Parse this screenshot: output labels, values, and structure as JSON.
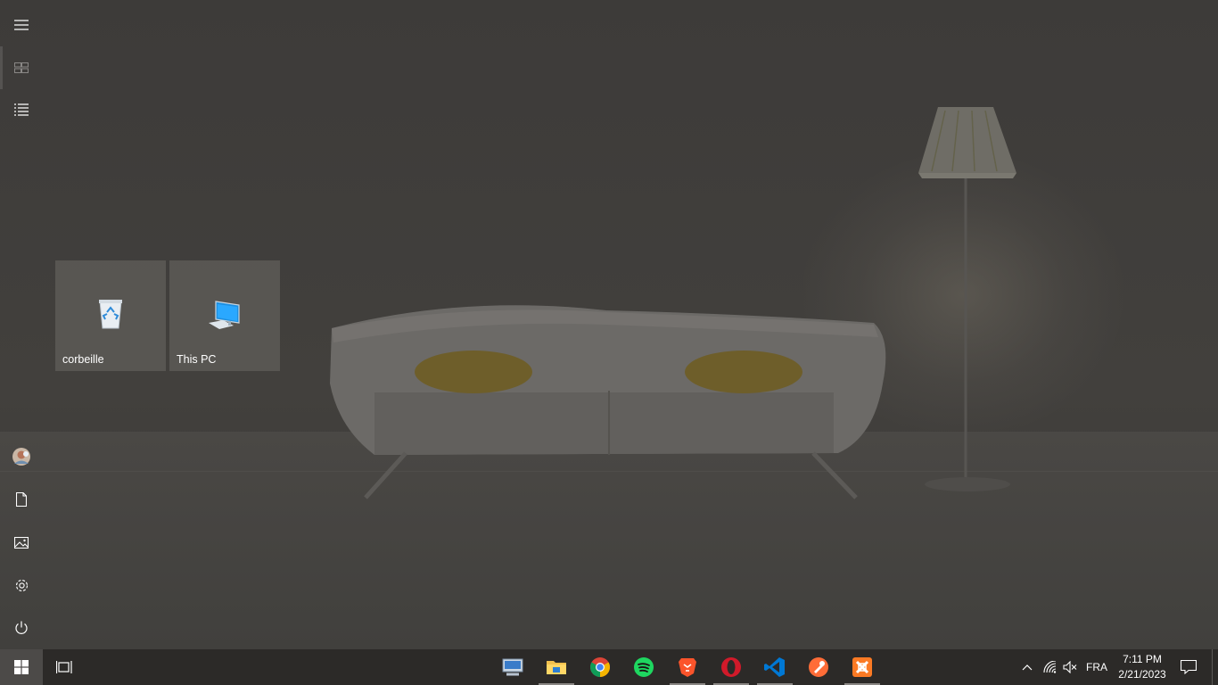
{
  "start_menu": {
    "rail_top": [
      {
        "name": "hamburger-icon"
      },
      {
        "name": "tiles-icon"
      },
      {
        "name": "all-apps-list-icon"
      }
    ],
    "rail_bottom": [
      {
        "name": "user-avatar"
      },
      {
        "name": "documents-icon"
      },
      {
        "name": "pictures-icon"
      },
      {
        "name": "settings-gear-icon"
      },
      {
        "name": "power-icon"
      }
    ],
    "tiles": [
      {
        "label": "corbeille",
        "icon": "recycle-bin-icon"
      },
      {
        "label": "This PC",
        "icon": "computer-icon"
      }
    ]
  },
  "taskbar": {
    "start_icon": "windows-logo-icon",
    "task_view_icon": "task-view-icon",
    "apps": [
      {
        "name": "remote-desktop-icon",
        "running": false
      },
      {
        "name": "file-explorer-icon",
        "running": true
      },
      {
        "name": "chrome-icon",
        "running": false
      },
      {
        "name": "spotify-icon",
        "running": false
      },
      {
        "name": "brave-icon",
        "running": true
      },
      {
        "name": "opera-icon",
        "running": true
      },
      {
        "name": "vscode-icon",
        "running": true
      },
      {
        "name": "postman-icon",
        "running": false
      },
      {
        "name": "xampp-icon",
        "running": true
      }
    ],
    "tray": {
      "language": "FRA",
      "time": "7:11 PM",
      "date": "2/21/2023"
    }
  },
  "colors": {
    "taskbar": "#2c2a28",
    "start_button_active": "#4c4a48",
    "tile": "#5f5c58"
  }
}
